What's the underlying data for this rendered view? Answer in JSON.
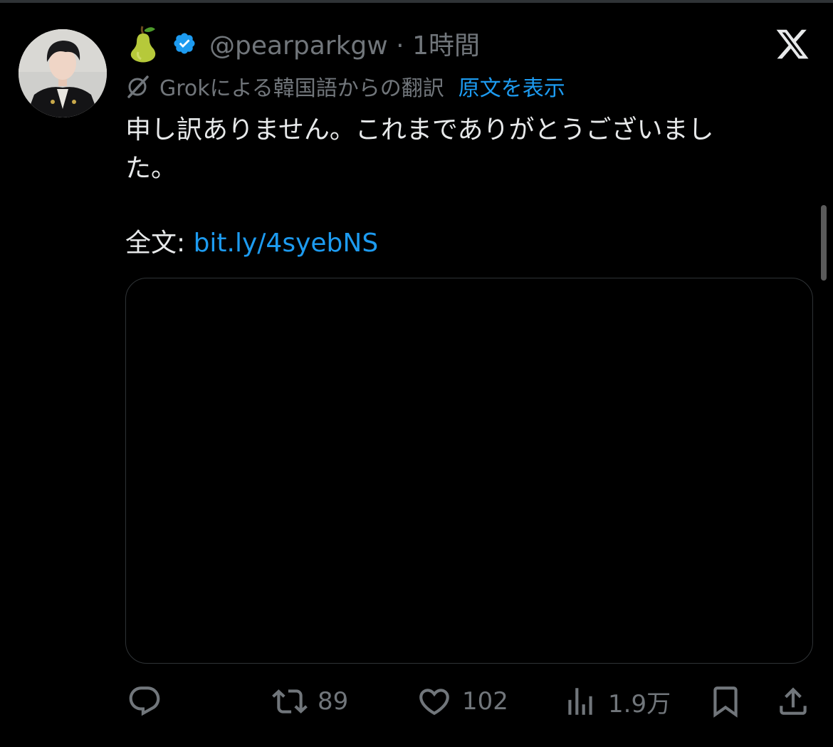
{
  "tweet": {
    "handle": "@pearparkgw",
    "separator": "·",
    "time": "1時間",
    "pear_emoji": "🍐",
    "verified": true,
    "translation_label": "Grokによる韓国語からの翻訳",
    "show_original": "原文を表示",
    "text_line1": "申し訳ありません。これまでありがとうございまし",
    "text_line2": "た。",
    "fulltext_label": "全文: ",
    "fulltext_link": "bit.ly/4syebNS"
  },
  "actions": {
    "reply_icon": "reply-icon",
    "retweet_count": "89",
    "like_count": "102",
    "views_count": "1.9万",
    "bookmark_icon": "bookmark-icon",
    "share_icon": "share-icon"
  },
  "colors": {
    "background": "#000000",
    "text": "#e7e9ea",
    "muted": "#71767b",
    "link": "#1d9bf0",
    "verified": "#1d9bf0",
    "border": "#2f3336"
  }
}
